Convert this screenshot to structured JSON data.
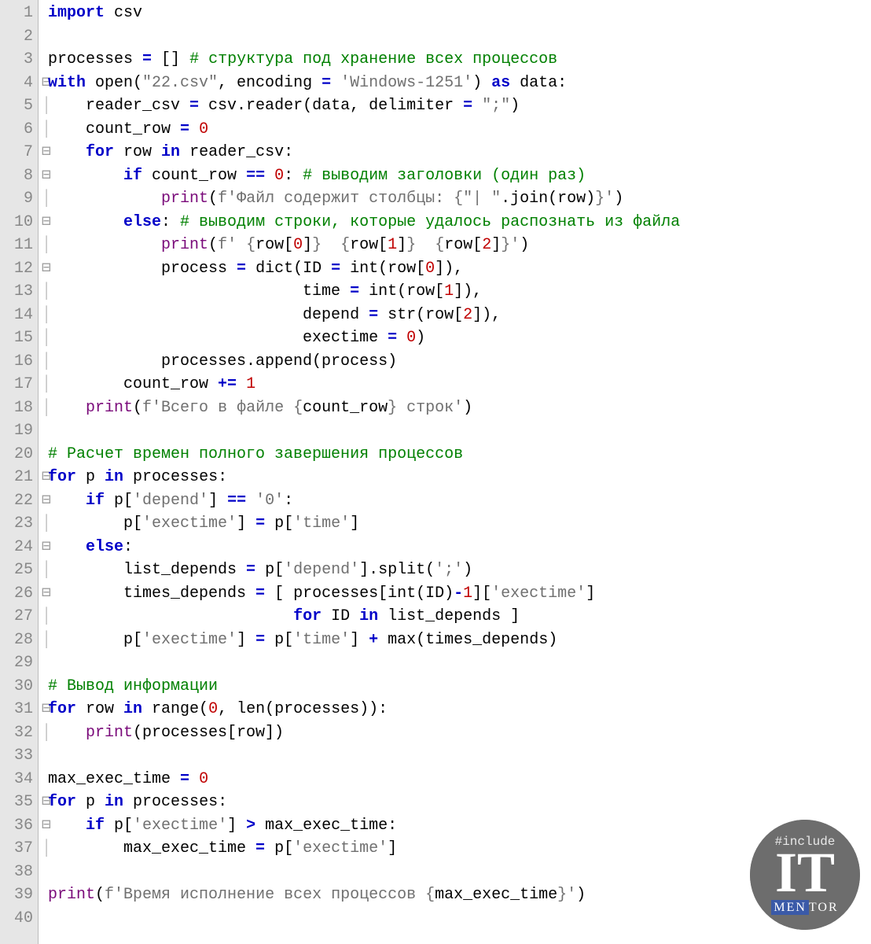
{
  "lines": [
    {
      "n": "1",
      "fold": "",
      "html": "<span class='kw'>import</span> csv"
    },
    {
      "n": "2",
      "fold": "",
      "html": ""
    },
    {
      "n": "3",
      "fold": "",
      "html": "processes <span class='op'>=</span> [] <span class='c'># структура под хранение всех процессов</span>"
    },
    {
      "n": "4",
      "fold": "⊟",
      "html": "<span class='kw'>with</span> open(<span class='s'>\"22.csv\"</span>, encoding <span class='op'>=</span> <span class='s'>'Windows-1251'</span>) <span class='kw'>as</span> data:"
    },
    {
      "n": "5",
      "fold": "│",
      "html": "    reader_csv <span class='op'>=</span> csv.reader(data, delimiter <span class='op'>=</span> <span class='s'>\";\"</span>)"
    },
    {
      "n": "6",
      "fold": "│",
      "html": "    count_row <span class='op'>=</span> <span class='n'>0</span>"
    },
    {
      "n": "7",
      "fold": "⊟",
      "html": "    <span class='kw'>for</span> row <span class='kw'>in</span> reader_csv:"
    },
    {
      "n": "8",
      "fold": "⊟",
      "html": "        <span class='kw'>if</span> count_row <span class='op'>==</span> <span class='n'>0</span>: <span class='c'># выводим заголовки (один раз)</span>"
    },
    {
      "n": "9",
      "fold": "│",
      "html": "            <span class='w'>print</span>(<span class='s'>f'Файл содержит столбцы: {</span><span class='s'>\"| \"</span>.join(row)<span class='s'>}'</span>)"
    },
    {
      "n": "10",
      "fold": "⊟",
      "html": "        <span class='kw'>else</span>: <span class='c'># выводим строки, которые удалось распознать из файла</span>"
    },
    {
      "n": "11",
      "fold": "│",
      "html": "            <span class='w'>print</span>(<span class='s'>f' {</span>row[<span class='n'>0</span>]<span class='s'>}  {</span>row[<span class='n'>1</span>]<span class='s'>}  {</span>row[<span class='n'>2</span>]<span class='s'>}'</span>)"
    },
    {
      "n": "12",
      "fold": "⊟",
      "html": "            process <span class='op'>=</span> dict(ID <span class='op'>=</span> int(row[<span class='n'>0</span>]),"
    },
    {
      "n": "13",
      "fold": "│",
      "html": "                           time <span class='op'>=</span> int(row[<span class='n'>1</span>]),"
    },
    {
      "n": "14",
      "fold": "│",
      "html": "                           depend <span class='op'>=</span> str(row[<span class='n'>2</span>]),"
    },
    {
      "n": "15",
      "fold": "│",
      "html": "                           exectime <span class='op'>=</span> <span class='n'>0</span>)"
    },
    {
      "n": "16",
      "fold": "│",
      "html": "            processes.append(process)"
    },
    {
      "n": "17",
      "fold": "│",
      "html": "        count_row <span class='op'>+=</span> <span class='n'>1</span>"
    },
    {
      "n": "18",
      "fold": "│",
      "html": "    <span class='w'>print</span>(<span class='s'>f'Всего в файле {</span>count_row<span class='s'>} строк'</span>)"
    },
    {
      "n": "19",
      "fold": "",
      "html": ""
    },
    {
      "n": "20",
      "fold": "",
      "html": "<span class='c'># Расчет времен полного завершения процессов</span>"
    },
    {
      "n": "21",
      "fold": "⊟",
      "html": "<span class='kw'>for</span> p <span class='kw'>in</span> processes:"
    },
    {
      "n": "22",
      "fold": "⊟",
      "html": "    <span class='kw'>if</span> p[<span class='s'>'depend'</span>] <span class='op'>==</span> <span class='s'>'0'</span>:"
    },
    {
      "n": "23",
      "fold": "│",
      "html": "        p[<span class='s'>'exectime'</span>] <span class='op'>=</span> p[<span class='s'>'time'</span>]"
    },
    {
      "n": "24",
      "fold": "⊟",
      "html": "    <span class='kw'>else</span>:"
    },
    {
      "n": "25",
      "fold": "│",
      "html": "        list_depends <span class='op'>=</span> p[<span class='s'>'depend'</span>].split(<span class='s'>';'</span>)"
    },
    {
      "n": "26",
      "fold": "⊟",
      "html": "        times_depends <span class='op'>=</span> [ processes[int(ID)<span class='op'>-</span><span class='n'>1</span>][<span class='s'>'exectime'</span>]"
    },
    {
      "n": "27",
      "fold": "│",
      "html": "                          <span class='kw'>for</span> ID <span class='kw'>in</span> list_depends ]"
    },
    {
      "n": "28",
      "fold": "│",
      "html": "        p[<span class='s'>'exectime'</span>] <span class='op'>=</span> p[<span class='s'>'time'</span>] <span class='op'>+</span> max(times_depends)"
    },
    {
      "n": "29",
      "fold": "",
      "html": ""
    },
    {
      "n": "30",
      "fold": "",
      "html": "<span class='c'># Вывод информации</span>"
    },
    {
      "n": "31",
      "fold": "⊟",
      "html": "<span class='kw'>for</span> row <span class='kw'>in</span> range(<span class='n'>0</span>, len(processes)):"
    },
    {
      "n": "32",
      "fold": "│",
      "html": "    <span class='w'>print</span>(processes[row])"
    },
    {
      "n": "33",
      "fold": "",
      "html": ""
    },
    {
      "n": "34",
      "fold": "",
      "html": "max_exec_time <span class='op'>=</span> <span class='n'>0</span>"
    },
    {
      "n": "35",
      "fold": "⊟",
      "html": "<span class='kw'>for</span> p <span class='kw'>in</span> processes:"
    },
    {
      "n": "36",
      "fold": "⊟",
      "html": "    <span class='kw'>if</span> p[<span class='s'>'exectime'</span>] <span class='op'>&gt;</span> max_exec_time:"
    },
    {
      "n": "37",
      "fold": "│",
      "html": "        max_exec_time <span class='op'>=</span> p[<span class='s'>'exectime'</span>]"
    },
    {
      "n": "38",
      "fold": "",
      "html": ""
    },
    {
      "n": "39",
      "fold": "",
      "html": "<span class='w'>print</span>(<span class='s'>f'Время исполнение всех процессов {</span>max_exec_time<span class='s'>}'</span>)"
    },
    {
      "n": "40",
      "fold": "",
      "html": ""
    }
  ],
  "logo": {
    "include": "#include",
    "it": "IT",
    "men": "MEN",
    "tor": "TOR"
  }
}
